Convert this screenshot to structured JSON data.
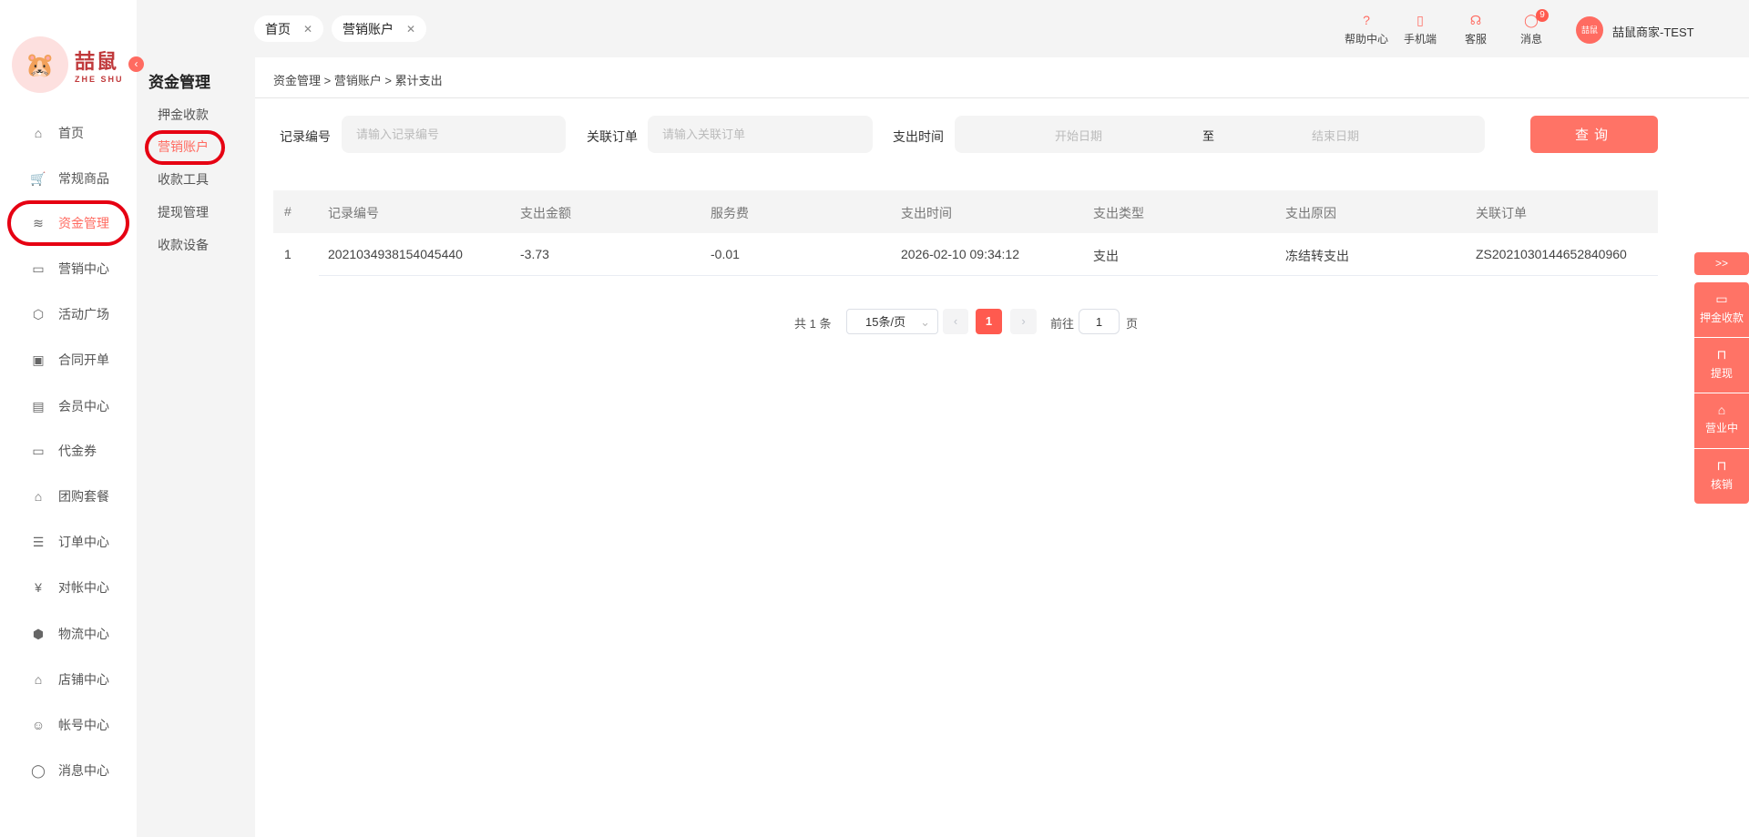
{
  "brand": {
    "name": "喆鼠",
    "sub": "ZHE SHU"
  },
  "nav": [
    {
      "label": "首页",
      "icon": "home-icon",
      "glyph": "⌂"
    },
    {
      "label": "常规商品",
      "icon": "cart-icon",
      "glyph": "🛒"
    },
    {
      "label": "资金管理",
      "icon": "layers-icon",
      "glyph": "≋",
      "active": true
    },
    {
      "label": "营销中心",
      "icon": "camera-icon",
      "glyph": "▭"
    },
    {
      "label": "活动广场",
      "icon": "box-upload-icon",
      "glyph": "⬡"
    },
    {
      "label": "合同开单",
      "icon": "contract-icon",
      "glyph": "▣"
    },
    {
      "label": "会员中心",
      "icon": "vip-card-icon",
      "glyph": "▤"
    },
    {
      "label": "代金券",
      "icon": "coupon-icon",
      "glyph": "▭"
    },
    {
      "label": "团购套餐",
      "icon": "tag-icon",
      "glyph": "⌂"
    },
    {
      "label": "订单中心",
      "icon": "order-icon",
      "glyph": "☰"
    },
    {
      "label": "对帐中心",
      "icon": "yen-icon",
      "glyph": "¥"
    },
    {
      "label": "物流中心",
      "icon": "package-icon",
      "glyph": "⬢"
    },
    {
      "label": "店铺中心",
      "icon": "store-icon",
      "glyph": "⌂"
    },
    {
      "label": "帐号中心",
      "icon": "user-icon",
      "glyph": "☺"
    },
    {
      "label": "消息中心",
      "icon": "chat-icon",
      "glyph": "◯"
    }
  ],
  "submenu": {
    "title": "资金管理",
    "items": [
      "押金收款",
      "营销账户",
      "收款工具",
      "提现管理",
      "收款设备"
    ],
    "active": 1
  },
  "tabs": [
    {
      "label": "首页"
    },
    {
      "label": "营销账户"
    }
  ],
  "tools": [
    {
      "label": "帮助中心",
      "glyph": "?"
    },
    {
      "label": "手机端",
      "glyph": "▯"
    },
    {
      "label": "客服",
      "glyph": "☊"
    },
    {
      "label": "消息",
      "glyph": "◯",
      "badge": "9"
    }
  ],
  "user": {
    "name": "喆鼠商家-TEST",
    "avatar": "喆鼠"
  },
  "breadcrumb": "资金管理 > 营销账户 > 累计支出",
  "filters": {
    "record_label": "记录编号",
    "record_placeholder": "请输入记录编号",
    "order_label": "关联订单",
    "order_placeholder": "请输入关联订单",
    "time_label": "支出时间",
    "start_placeholder": "开始日期",
    "to": "至",
    "end_placeholder": "结束日期",
    "query": "查询"
  },
  "table": {
    "headers": [
      "#",
      "记录编号",
      "支出金额",
      "服务费",
      "支出时间",
      "支出类型",
      "支出原因",
      "关联订单"
    ],
    "rows": [
      [
        "1",
        "2021034938154045440",
        "-3.73",
        "-0.01",
        "2026-02-10 09:34:12",
        "支出",
        "冻结转支出",
        "ZS2021030144652840960"
      ]
    ]
  },
  "pagination": {
    "total": "共 1 条",
    "page_size": "15条/页",
    "current": "1",
    "goto_label": "前往",
    "goto_value": "1",
    "page_suffix": "页"
  },
  "float": {
    "toggle": ">>",
    "items": [
      {
        "label": "押金收款",
        "glyph": "▭"
      },
      {
        "label": "提现",
        "glyph": "⊓"
      },
      {
        "label": "营业中",
        "glyph": "⌂"
      },
      {
        "label": "核销",
        "glyph": "⊓"
      }
    ]
  }
}
